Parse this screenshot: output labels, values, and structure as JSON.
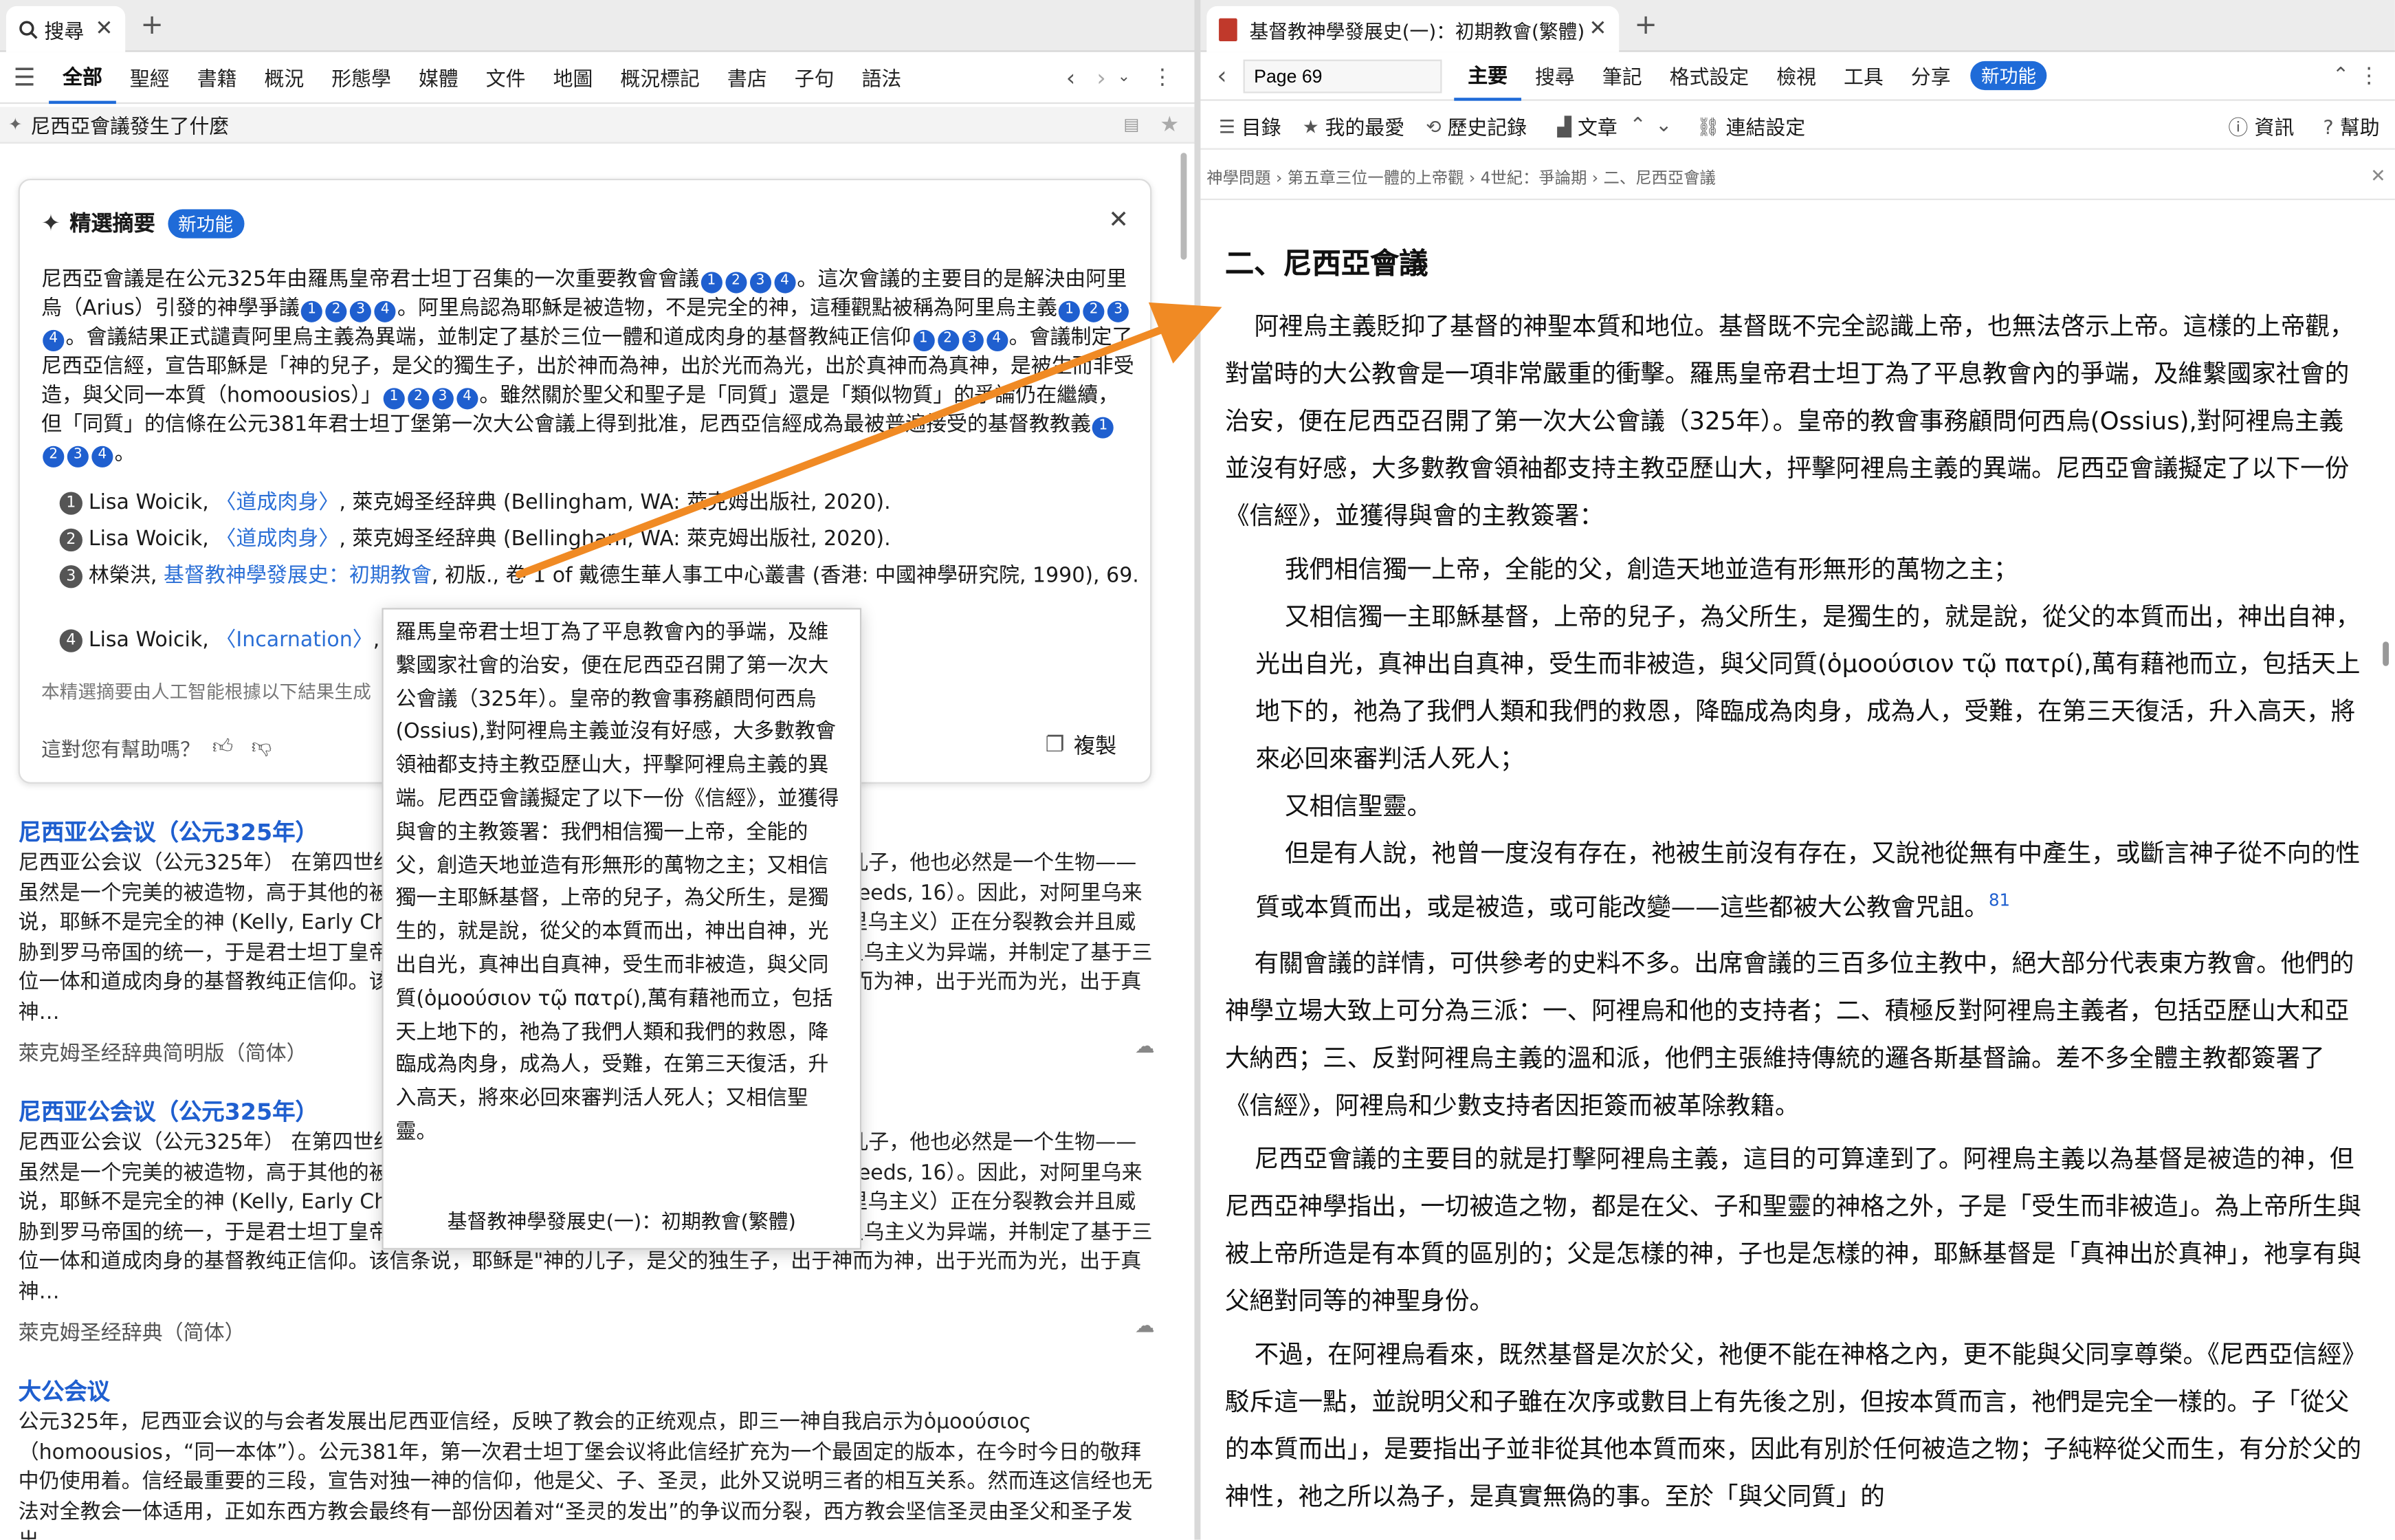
{
  "left": {
    "tab_title": "搜尋",
    "nav_tabs": [
      "全部",
      "聖經",
      "書籍",
      "概況",
      "形態學",
      "媒體",
      "文件",
      "地圖",
      "概況標記",
      "書店",
      "子句",
      "語法"
    ],
    "query": "尼西亞會議發生了什麼",
    "summary": {
      "title": "精選摘要",
      "badge": "新功能",
      "text1": "尼西亞會議是在公元325年由羅馬皇帝君士坦丁召集的一次重要教會會議",
      "text2": "。這次會議的主要目的是解決由阿里烏（Arius）引發的神學爭議",
      "text3": "。阿里烏認為耶穌是被造物，不是完全的神，這種觀點被稱為阿里烏主義",
      "text4": "。會議結果正式譴責阿里烏主義為異端，並制定了基於三位一體和道成肉身的基督教純正信仰",
      "text5": "。會議制定了尼西亞信經，宣告耶穌是「神的兒子，是父的獨生子，出於神而為神，出於光而為光，出於真神而為真神，是被生而非受造，與父同一本質（homoousios）」",
      "text6": "。雖然關於聖父和聖子是「同質」還是「類似物質」的爭論仍在繼續，但「同質」的信條在公元381年君士坦丁堡第一次大公會議上得到批准，尼西亞信經成為最被普遍接受的基督教教義",
      "sources": [
        {
          "n": "1",
          "author": "Lisa Woicik,",
          "title": "〈道成肉身〉",
          "rest": ", 萊克姆圣经辞典 (Bellingham, WA: 萊克姆出版社, 2020)."
        },
        {
          "n": "2",
          "author": "Lisa Woicik,",
          "title": "〈道成肉身〉",
          "rest": ", 萊克姆圣经辞典 (Bellingham, WA: 萊克姆出版社, 2020)."
        },
        {
          "n": "3",
          "author": "林榮洪,",
          "title": "基督教神學發展史：初期教會",
          "rest": ", 初版., 卷 1 of 戴德生華人事工中心叢書 (香港: 中國神學研究院, 1990), 69."
        },
        {
          "n": "4",
          "author": "Lisa Woicik,",
          "title": "〈Incarnation〉",
          "rest": ", 2020)."
        }
      ],
      "disclaimer": "本精選摘要由人工智能根據以下結果生成",
      "helpful": "這對您有幫助嗎？",
      "copy": "複製"
    },
    "results": [
      {
        "title": "尼西亚公会议（公元325年）",
        "body": "尼西亚公会议（公元325年） 在第四世纪，亚历山大的长老阿里乌教导说，虽然耶稣是神的儿子，他也必然是一个生物——虽然是一个完美的被造物，高于其他的被造物，但他不是永恒的（Kelly, Early Christian Creeds, 16）。因此，对阿里乌来说，耶稣不是完全的神 (Kelly, Early Christian Creeds)。关于耶稣本质的争论（被称为阿里乌主义）正在分裂教会并且威胁到罗马帝国的统一，于是君士坦丁皇帝在尼西亚召集了教会的主教们。结果是正式谴责阿里乌主义为异端，并制定了基于三位一体和道成肉身的基督教纯正信仰。该信条说，耶稣是\"神的儿子，是父的独生子，出于神而为神，出于光而为光，出于真神…",
        "source": "萊克姆圣经辞典简明版（简体）"
      },
      {
        "title": "尼西亚公会议（公元325年）",
        "body": "尼西亚公会议（公元325年） 在第四世纪，亚历山大的长老阿里乌教导说，虽然耶稣是神的儿子，他也必然是一个生物——虽然是一个完美的被造物，高于其他的被造物，但他不是永恒的（Kelly, Early Christian Creeds, 16）。因此，对阿里乌来说，耶稣不是完全的神 (Kelly, Early Christian Creeds)。关于耶稣本质的争论（被称为阿里乌主义）正在分裂教会并且威胁到罗马帝国的统一，于是君士坦丁皇帝在尼西亚召集了教会的主教们。结果是正式谴责阿里乌主义为异端，并制定了基于三位一体和道成肉身的基督教纯正信仰。该信条说，耶稣是\"神的儿子，是父的独生子，出于神而为神，出于光而为光，出于真神…",
        "source": "萊克姆圣经辞典（简体）"
      },
      {
        "title": "大公会议",
        "body": "公元325年，尼西亚会议的与会者发展出尼西亚信经，反映了教会的正统观点，即三一神自我启示为ὁμοούσιος（homoousios，“同一本体”）。公元381年，第一次君士坦丁堡会议将此信经扩充为一个最固定的版本，在今时今日的敬拜中仍使用着。信经最重要的三段，宣告对独一神的信仰，他是父、子、圣灵，此外又说明三者的相互关系。然而连这信经也无法对全教会一体适用，正如东西方教会最终有一部份因着对“圣灵的发出”的争议而分裂，西方教会坚信圣灵由圣父和圣子发出。",
        "source": ""
      }
    ],
    "popup": {
      "text": "羅馬皇帝君士坦丁為了平息教會內的爭端，及維繫國家社會的治安，便在尼西亞召開了第一次大公會議（325年）。皇帝的教會事務顧問何西烏(Ossius),對阿裡烏主義並沒有好感，大多數教會領袖都支持主教亞歷山大，抨擊阿裡烏主義的異端。尼西亞會議擬定了以下一份《信經》，並獲得與會的主教簽署：我們相信獨一上帝，全能的父，創造天地並造有形無形的萬物之主；又相信獨一主耶穌基督，上帝的兒子，為父所生，是獨生的，就是說，從父的本質而出，神出自神，光出自光，真神出自真神，受生而非被造，與父同質(ὁμοούσιον τῷ πατρί),萬有藉祂而立，包括天上地下的，祂為了我們人類和我們的救恩，降臨成為肉身，成為人，受難，在第三天復活，升入高天，將來必回來審判活人死人；又相信聖靈。",
      "footer": "基督教神學發展史(一)：初期教會(繁體)"
    }
  },
  "right": {
    "tab_title": "基督教神學發展史(一)：初期教會(繁體)",
    "page": "Page 69",
    "menu": [
      "主要",
      "搜尋",
      "筆記",
      "格式設定",
      "檢視",
      "工具",
      "分享"
    ],
    "menu_badge": "新功能",
    "toolbar": [
      "目錄",
      "我的最愛",
      "歷史記錄",
      "文章",
      "連結設定"
    ],
    "info": "資訊",
    "help": "幫助",
    "breadcrumb": "神學問題 › 第五章三位一體的上帝觀 › 4世紀：爭論期 › 二、尼西亞會議",
    "heading": "二、尼西亞會議",
    "p1": "阿裡烏主義貶抑了基督的神聖本質和地位。基督既不完全認識上帝，也無法啓示上帝。這樣的上帝觀，對當時的大公教會是一項非常嚴重的衝擊。羅馬皇帝君士坦丁為了平息教會內的爭端，及維繫國家社會的治安，便在尼西亞召開了第一次大公會議（325年）。皇帝的教會事務顧問何西烏(Ossius),對阿裡烏主義並沒有好感，大多數教會領袖都支持主教亞歷山大，抨擊阿裡烏主義的異端。尼西亞會議擬定了以下一份《信經》，並獲得與會的主教簽署：",
    "q1": "我們相信獨一上帝，全能的父，創造天地並造有形無形的萬物之主；",
    "q2": "又相信獨一主耶穌基督，上帝的兒子，為父所生，是獨生的，就是說，從父的本質而出，神出自神，光出自光，真神出自真神，受生而非被造，與父同質(ὁμοούσιον τῷ πατρί),萬有藉祂而立，包括天上地下的，祂為了我們人類和我們的救恩，降臨成為肉身，成為人，受難，在第三天復活，升入高天，將來必回來審判活人死人；",
    "q3": "又相信聖靈。",
    "q4": "但是有人說，祂曾一度沒有存在，祂被生前沒有存在，又說祂從無有中產生，或斷言神子從不向的性質或本質而出，或是被造，或可能改變——這些都被大公教會咒詛。",
    "q4_note": "81",
    "p2": "有關會議的詳情，可供參考的史料不多。出席會議的三百多位主教中，絕大部分代表東方教會。他們的神學立場大致上可分為三派：一、阿裡烏和他的支持者；二、積極反對阿裡烏主義者，包括亞歷山大和亞大納西；三、反對阿裡烏主義的溫和派，他們主張維持傳統的邏各斯基督論。差不多全體主教都簽署了《信經》，阿裡烏和少數支持者因拒簽而被革除教籍。",
    "p3": "尼西亞會議的主要目的就是打擊阿裡烏主義，這目的可算達到了。阿裡烏主義以為基督是被造的神，但尼西亞神學指出，一切被造之物，都是在父、子和聖靈的神格之外，子是「受生而非被造」。為上帝所生與被上帝所造是有本質的區別的；父是怎樣的神，子也是怎樣的神，耶穌基督是「真神出於真神」，祂享有與父絕對同等的神聖身份。",
    "p4": "不過，在阿裡烏看來，既然基督是次於父，祂便不能在神格之內，更不能與父同享尊榮。《尼西亞信經》駁斥這一點，並說明父和子雖在次序或數目上有先後之別，但按本質而言，祂們是完全一樣的。子「從父的本質而出」，是要指出子並非從其他本質而來，因此有別於任何被造之物；子純粹從父而生，有分於父的神性，祂之所以為子，是真實無偽的事。至於「與父同質」的"
  },
  "colors": {
    "accent": "#1f6bd8",
    "arrow": "#f08a24",
    "link": "#2b6fd6"
  }
}
